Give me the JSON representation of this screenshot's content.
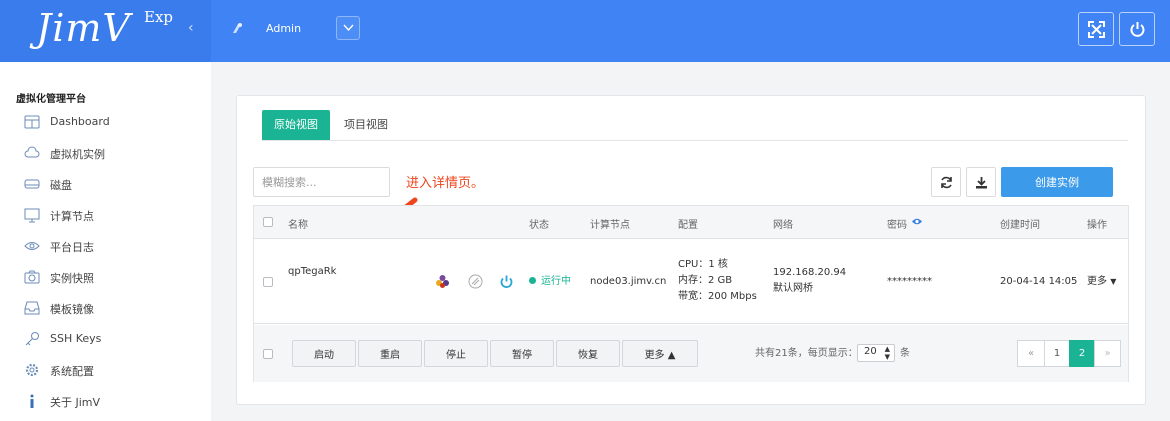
{
  "brand": {
    "logo": "JimV",
    "edition": "Exp",
    "collapse_glyph": "‹"
  },
  "topbar": {
    "user": "Admin",
    "fullscreen_icon": "expand-icon",
    "power_icon": "power-icon"
  },
  "sidebar": {
    "title": "虚拟化管理平台",
    "items": [
      {
        "label": "Dashboard",
        "icon": "dashboard-icon"
      },
      {
        "label": "虚拟机实例",
        "icon": "cloud-icon"
      },
      {
        "label": "磁盘",
        "icon": "disk-icon"
      },
      {
        "label": "计算节点",
        "icon": "monitor-icon"
      },
      {
        "label": "平台日志",
        "icon": "eye-icon"
      },
      {
        "label": "实例快照",
        "icon": "camera-icon"
      },
      {
        "label": "模板镜像",
        "icon": "inbox-icon"
      },
      {
        "label": "SSH Keys",
        "icon": "key-icon"
      },
      {
        "label": "系统配置",
        "icon": "gear-icon"
      },
      {
        "label": "关于 JimV",
        "icon": "info-icon"
      }
    ]
  },
  "tabs": [
    {
      "label": "原始视图",
      "active": true
    },
    {
      "label": "项目视图",
      "active": false
    }
  ],
  "toolbar": {
    "search_placeholder": "模糊搜索...",
    "create_label": "创建实例",
    "refresh_icon": "refresh-icon",
    "download_icon": "download-icon"
  },
  "annotation": "进入详情页。",
  "table": {
    "headers": {
      "name": "名称",
      "status": "状态",
      "node": "计算节点",
      "config": "配置",
      "network": "网络",
      "password": "密码",
      "created": "创建时间",
      "action": "操作"
    },
    "rows": [
      {
        "name": "qpTegaRk",
        "status": "运行中",
        "node": "node03.jimv.cn",
        "cpu": "CPU：1 核",
        "mem": "内存：2 GB",
        "bw": "带宽：200 Mbps",
        "ip": "192.168.20.94",
        "bridge": "默认网桥",
        "password": "*********",
        "created": "20-04-14 14:05",
        "more": "更多"
      }
    ]
  },
  "actions": {
    "start": "启动",
    "restart": "重启",
    "stop": "停止",
    "pause": "暂停",
    "resume": "恢复",
    "more": "更多 ▲"
  },
  "pagination": {
    "summary": "共有21条，每页显示：",
    "per_page": "20",
    "unit": "条",
    "prev": "«",
    "pages": [
      "1",
      "2"
    ],
    "current": "2",
    "next": "»"
  },
  "colors": {
    "topbar": "#3f83f5",
    "accent": "#1ab394",
    "create": "#3b9bea",
    "annotation": "#f0441c"
  }
}
